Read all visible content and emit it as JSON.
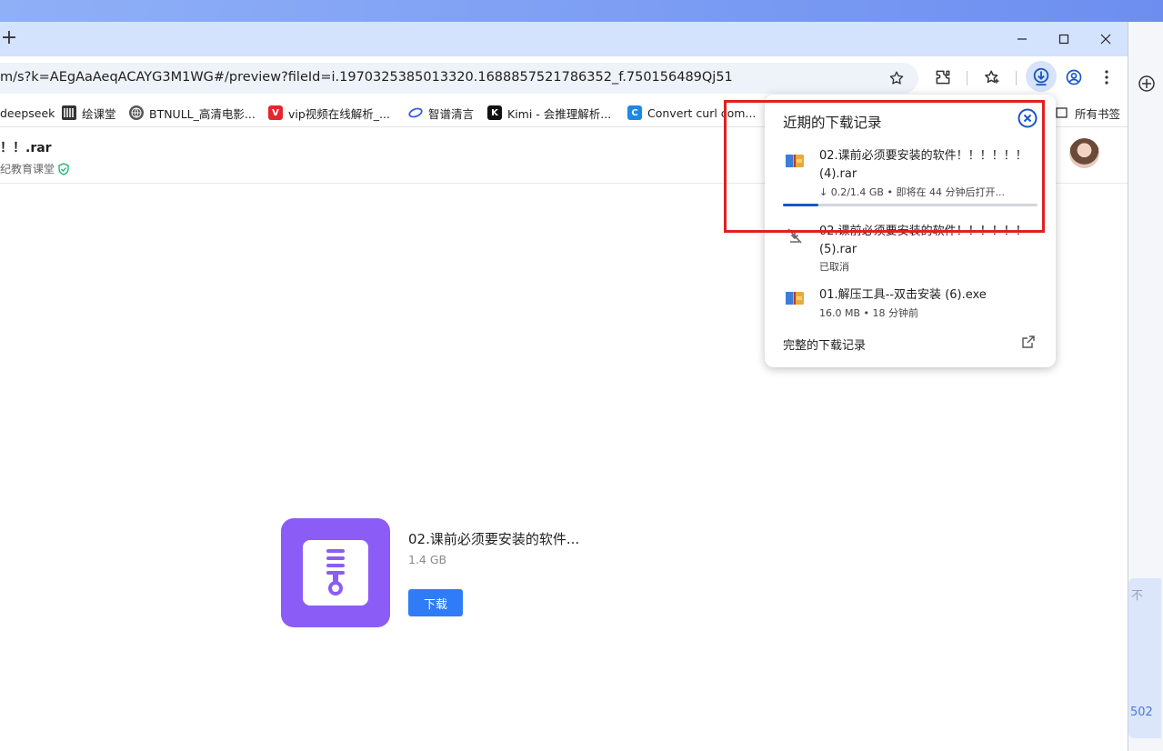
{
  "browser": {
    "new_tab_glyph": "+",
    "url": "m/s?k=AEgAaAeqACAYG3M1WG#/preview?fileId=i.1970325385013320.1688857521786352_f.750156489Qj51"
  },
  "bookmarks": {
    "items": [
      {
        "label": "deepseek",
        "icon": "deepseek-icon"
      },
      {
        "label": "绘课堂",
        "icon": "huiketang-icon"
      },
      {
        "label": "BTNULL_高清电影...",
        "icon": "globe-icon"
      },
      {
        "label": "vip视频在线解析_...",
        "icon": "v-icon",
        "color": "#e4262c"
      },
      {
        "label": "智谱清言",
        "icon": "zhipu-icon"
      },
      {
        "label": "Kimi - 会推理解析...",
        "icon": "kimi-icon"
      },
      {
        "label": "Convert curl com...",
        "icon": "curl-icon",
        "color": "#1e88e5"
      }
    ],
    "all_bookmarks": "所有书签"
  },
  "page": {
    "file_name": "！！.rar",
    "owner": "纪教育课堂",
    "file_title": "02.课前必须要安装的软件...",
    "file_size": "1.4 GB",
    "download_button": "下载",
    "accent_color": "#8b5cf6"
  },
  "download_panel": {
    "title": "近期的下载记录",
    "items": [
      {
        "name": "02.课前必须要安装的软件！！！！！！(4).rar",
        "status": "↓ 0.2/1.4 GB • 即将在 44 分钟后打开...",
        "progress": 0.14,
        "icon": "archive-file-icon"
      },
      {
        "name": "02.课前必须要安装的软件！！！！！！(5).rar",
        "status": "已取消",
        "icon": "cancelled-icon"
      },
      {
        "name": "01.解压工具--双击安装 (6).exe",
        "status": "16.0 MB • 18 分钟前",
        "icon": "exe-file-icon"
      }
    ],
    "full_history": "完整的下载记录"
  },
  "side_window": {
    "text_top": "不",
    "text_bottom": "502"
  }
}
